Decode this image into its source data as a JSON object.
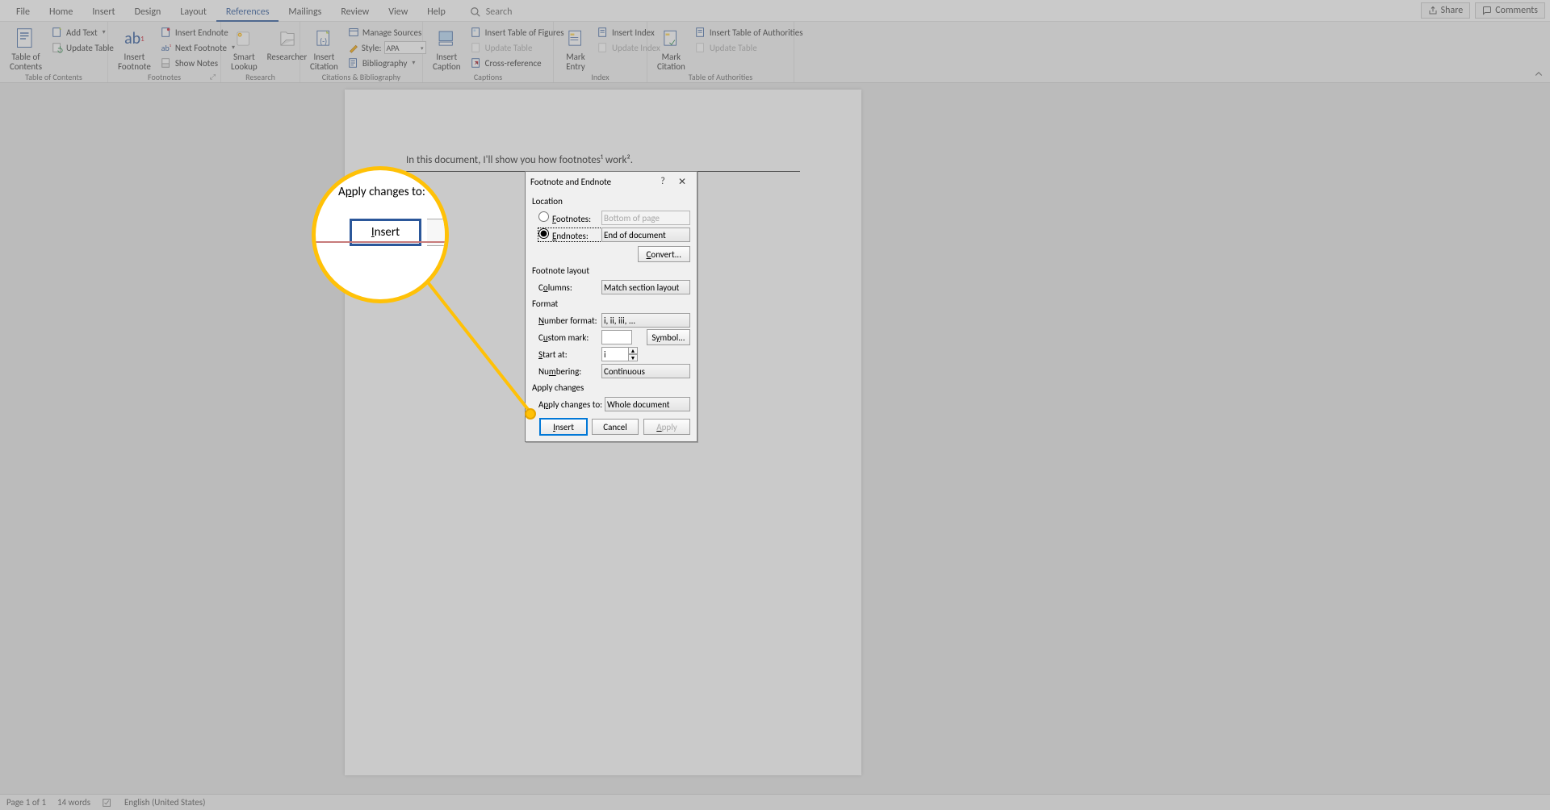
{
  "menubar": {
    "tabs": [
      "File",
      "Home",
      "Insert",
      "Design",
      "Layout",
      "References",
      "Mailings",
      "Review",
      "View",
      "Help"
    ],
    "search": "Search",
    "share": "Share",
    "comments": "Comments"
  },
  "ribbon": {
    "toc": {
      "main": "Table of\nContents",
      "add_text": "Add Text",
      "update": "Update Table",
      "label": "Table of Contents"
    },
    "footnotes": {
      "insert_footnote": "Insert\nFootnote",
      "ab": "ab",
      "insert_endnote": "Insert Endnote",
      "next_footnote": "Next Footnote",
      "show_notes": "Show Notes",
      "label": "Footnotes"
    },
    "research": {
      "smart": "Smart\nLookup",
      "researcher": "Researcher",
      "label": "Research"
    },
    "citations": {
      "insert_citation": "Insert\nCitation",
      "manage": "Manage Sources",
      "style_lbl": "Style:",
      "style_val": "APA",
      "bibliography": "Bibliography",
      "label": "Citations & Bibliography"
    },
    "captions": {
      "insert_caption": "Insert\nCaption",
      "tof": "Insert Table of Figures",
      "update": "Update Table",
      "cross": "Cross-reference",
      "label": "Captions"
    },
    "index": {
      "mark": "Mark\nEntry",
      "insert_index": "Insert Index",
      "update": "Update Index",
      "label": "Index"
    },
    "toa": {
      "mark": "Mark\nCitation",
      "insert": "Insert Table of Authorities",
      "update": "Update Table",
      "label": "Table of Authorities"
    }
  },
  "document": {
    "body": "In this document, I'll show you how footnotes¹ work²."
  },
  "dialog": {
    "title": "Footnote and Endnote",
    "section_location": "Location",
    "footnotes": "Footnotes:",
    "footnotes_val": "Bottom of page",
    "endnotes": "Endnotes:",
    "endnotes_val": "End of document",
    "convert": "Convert...",
    "section_layout": "Footnote layout",
    "columns": "Columns:",
    "columns_val": "Match section layout",
    "section_format": "Format",
    "number_format": "Number format:",
    "number_format_val": "i, ii, iii, ...",
    "custom_mark": "Custom mark:",
    "symbol": "Symbol...",
    "start_at": "Start at:",
    "start_at_val": "i",
    "numbering": "Numbering:",
    "numbering_val": "Continuous",
    "section_apply": "Apply changes",
    "apply_to": "Apply changes to:",
    "apply_to_val": "Whole document",
    "insert": "Insert",
    "cancel": "Cancel",
    "apply": "Apply"
  },
  "callout": {
    "label": "Apply changes to:",
    "btn": "Insert"
  },
  "statusbar": {
    "page": "Page 1 of 1",
    "words": "14 words",
    "lang": "English (United States)"
  }
}
